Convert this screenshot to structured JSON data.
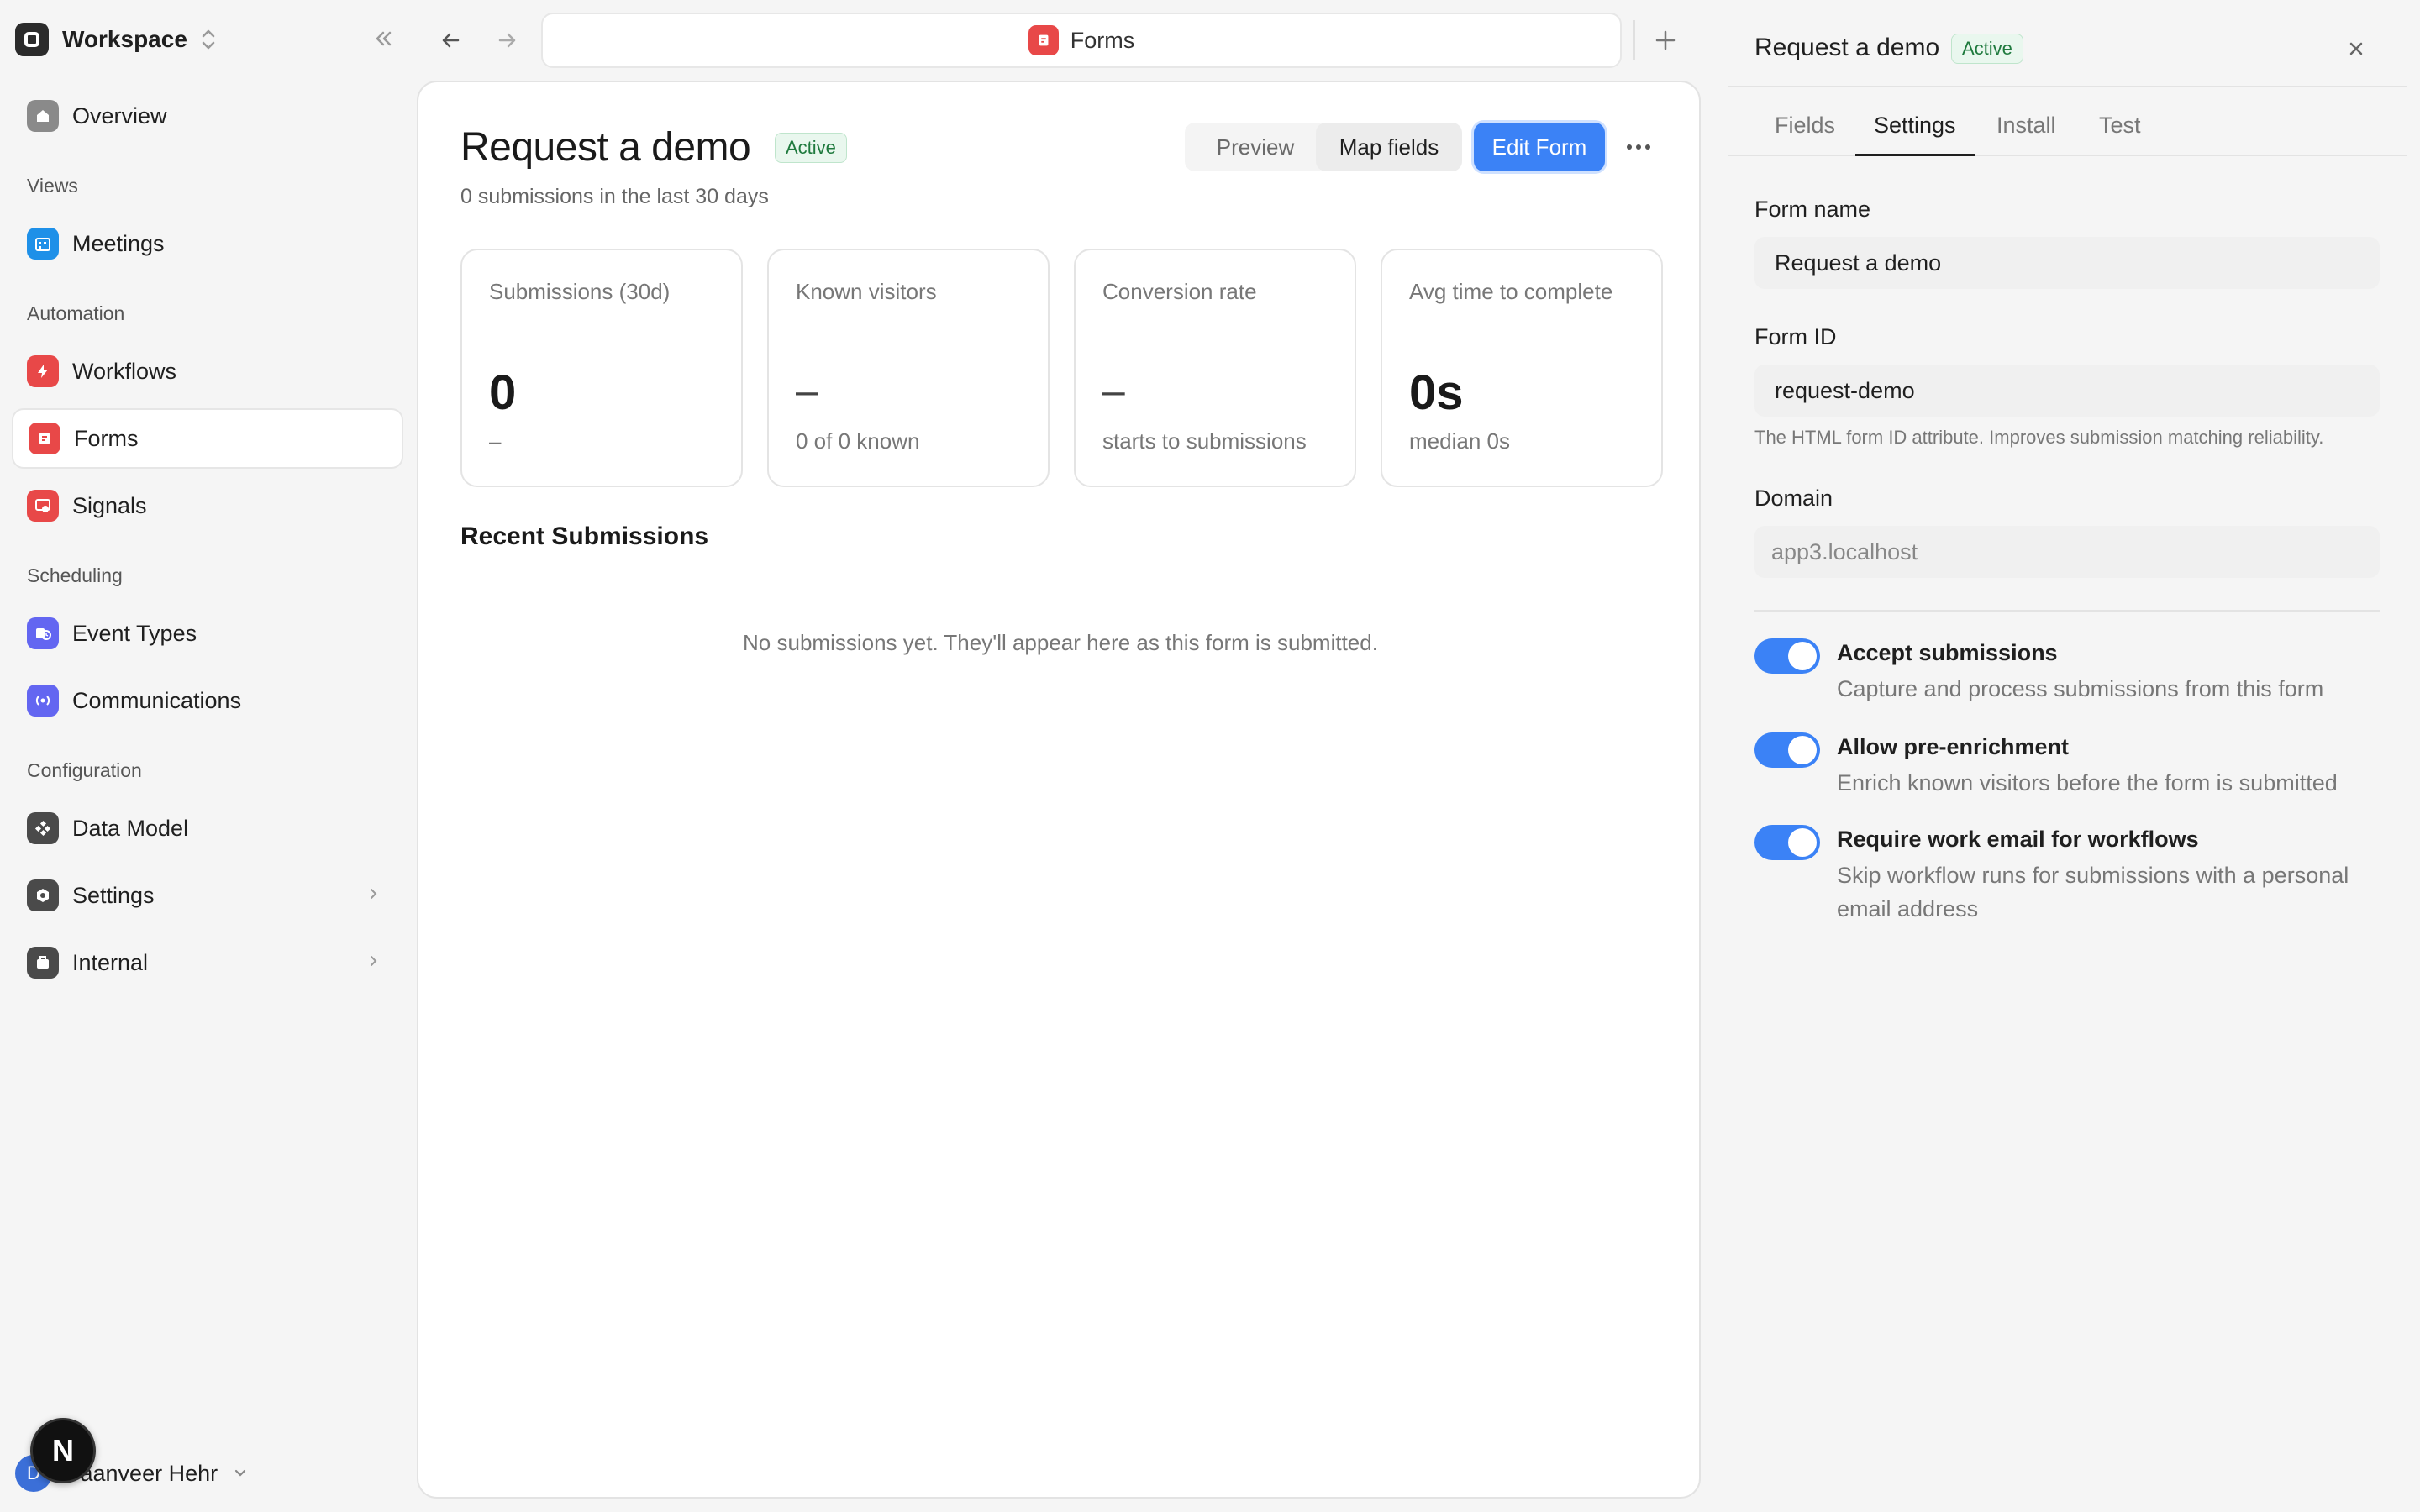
{
  "sidebar": {
    "workspace_name": "Workspace",
    "items": {
      "overview": "Overview",
      "meetings": "Meetings",
      "workflows": "Workflows",
      "forms": "Forms",
      "signals": "Signals",
      "event_types": "Event Types",
      "communications": "Communications",
      "data_model": "Data Model",
      "settings": "Settings",
      "internal": "Internal"
    },
    "sections": {
      "views": "Views",
      "automation": "Automation",
      "scheduling": "Scheduling",
      "configuration": "Configuration"
    },
    "user": {
      "initial": "D",
      "name": "Daanveer Hehr"
    },
    "next_badge": "N"
  },
  "topbar": {
    "url_title": "Forms"
  },
  "main": {
    "title": "Request a demo",
    "status_badge": "Active",
    "subtitle": "0 submissions in the last 30 days",
    "buttons": {
      "preview": "Preview",
      "map_fields": "Map fields",
      "edit_form": "Edit Form",
      "more": "···"
    },
    "stats": [
      {
        "label": "Submissions (30d)",
        "value": "0",
        "note": "–"
      },
      {
        "label": "Known visitors",
        "value": "–",
        "note": "0 of 0 known"
      },
      {
        "label": "Conversion rate",
        "value": "–",
        "note": "starts to submissions"
      },
      {
        "label": "Avg time to complete",
        "value": "0s",
        "note": "median 0s"
      }
    ],
    "recent_title": "Recent Submissions",
    "empty_message": "No submissions yet. They'll appear here as this form is submitted."
  },
  "panel": {
    "title": "Request a demo",
    "status_badge": "Active",
    "tabs": {
      "fields": "Fields",
      "settings": "Settings",
      "install": "Install",
      "test": "Test"
    },
    "form_name_label": "Form name",
    "form_name_value": "Request a demo",
    "form_id_label": "Form ID",
    "form_id_value": "request-demo",
    "form_id_help": "The HTML form ID attribute. Improves submission matching reliability.",
    "domain_label": "Domain",
    "domain_value": "app3.localhost",
    "toggles": [
      {
        "title": "Accept submissions",
        "desc": "Capture and process submissions from this form",
        "on": true
      },
      {
        "title": "Allow pre-enrichment",
        "desc": "Enrich known visitors before the form is submitted",
        "on": true
      },
      {
        "title": "Require work email for workflows",
        "desc": "Skip workflow runs for submissions with a personal email address",
        "on": true
      }
    ]
  },
  "colors": {
    "accent": "#3b82f6",
    "forms_red": "#e84848",
    "active_green": "#1f7a3e"
  }
}
